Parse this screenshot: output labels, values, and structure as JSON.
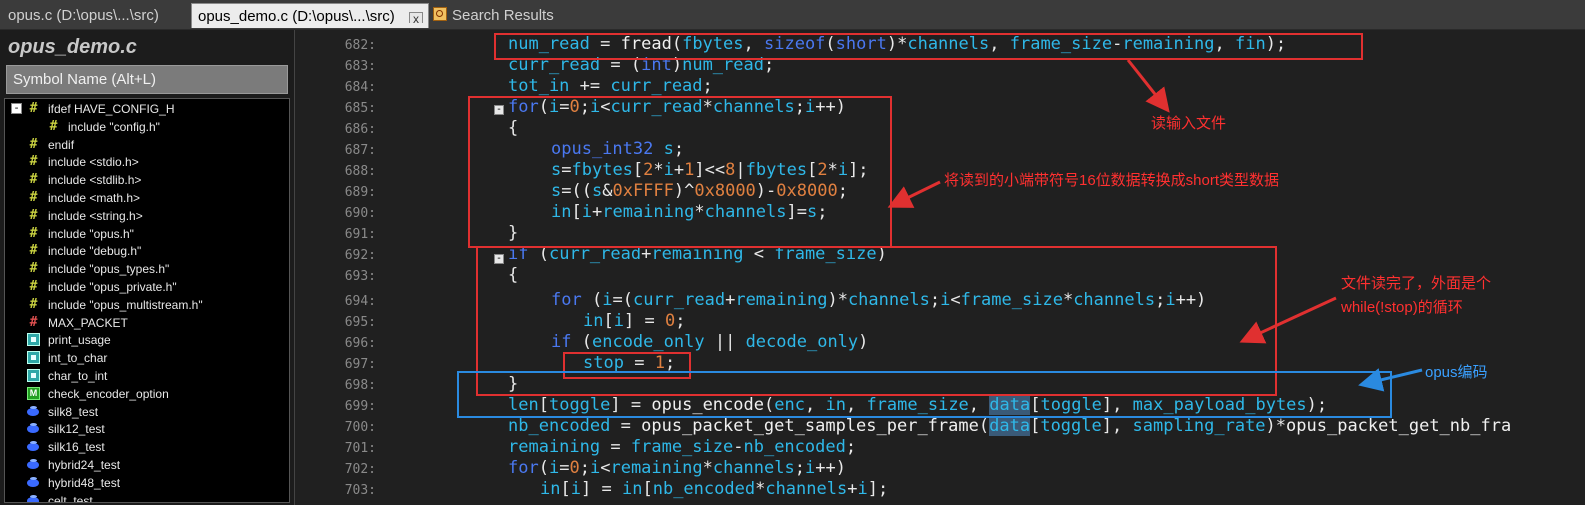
{
  "tabs": [
    {
      "label": "opus.c (D:\\opus\\...\\src)",
      "active": false
    },
    {
      "label": "opus_demo.c (D:\\opus\\...\\src)",
      "active": true,
      "close": "x"
    },
    {
      "label": "Search Results",
      "active": false
    }
  ],
  "sidebar": {
    "title": "opus_demo.c",
    "search_placeholder": "Symbol Name (Alt+L)",
    "items": [
      {
        "label": "ifdef HAVE_CONFIG_H",
        "icon": "hash-icon"
      },
      {
        "label": "include \"config.h\"",
        "icon": "hash-icon"
      },
      {
        "label": "endif",
        "icon": "hash-icon"
      },
      {
        "label": "include <stdio.h>",
        "icon": "hash-icon"
      },
      {
        "label": "include <stdlib.h>",
        "icon": "hash-icon"
      },
      {
        "label": "include <math.h>",
        "icon": "hash-icon"
      },
      {
        "label": "include <string.h>",
        "icon": "hash-icon"
      },
      {
        "label": "include \"opus.h\"",
        "icon": "hash-icon"
      },
      {
        "label": "include \"debug.h\"",
        "icon": "hash-icon"
      },
      {
        "label": "include \"opus_types.h\"",
        "icon": "hash-icon"
      },
      {
        "label": "include \"opus_private.h\"",
        "icon": "hash-icon"
      },
      {
        "label": "include \"opus_multistream.h\"",
        "icon": "hash-icon"
      },
      {
        "label": "MAX_PACKET",
        "icon": "macro-icon"
      },
      {
        "label": "print_usage",
        "icon": "function-icon"
      },
      {
        "label": "int_to_char",
        "icon": "function-icon"
      },
      {
        "label": "char_to_int",
        "icon": "function-icon"
      },
      {
        "label": "check_encoder_option",
        "icon": "main-function-icon"
      },
      {
        "label": "silk8_test",
        "icon": "variable-icon"
      },
      {
        "label": "silk12_test",
        "icon": "variable-icon"
      },
      {
        "label": "silk16_test",
        "icon": "variable-icon"
      },
      {
        "label": "hybrid24_test",
        "icon": "variable-icon"
      },
      {
        "label": "hybrid48_test",
        "icon": "variable-icon"
      },
      {
        "label": "celt_test",
        "icon": "variable-icon"
      }
    ]
  },
  "editor": {
    "line_numbers": [
      "682:",
      "683:",
      "684:",
      "685:",
      "686:",
      "687:",
      "688:",
      "689:",
      "690:",
      "691:",
      "692:",
      "693:",
      "694:",
      "695:",
      "696:",
      "697:",
      "698:",
      "699:",
      "700:",
      "701:",
      "702:",
      "703:"
    ]
  },
  "annotations": {
    "read_file": "读输入文件",
    "convert": "将读到的小端带符号16位数据转换成short类型数据",
    "file_done_1": "文件读完了，外面是个",
    "file_done_2": "while(!stop)的循环",
    "opus_encode": "opus编码"
  },
  "colors": {
    "annotation_red": "#e03030",
    "annotation_blue": "#2a8ae0",
    "keyword": "#4a78f0",
    "variable": "#2fb8e8",
    "number": "#e08040"
  }
}
